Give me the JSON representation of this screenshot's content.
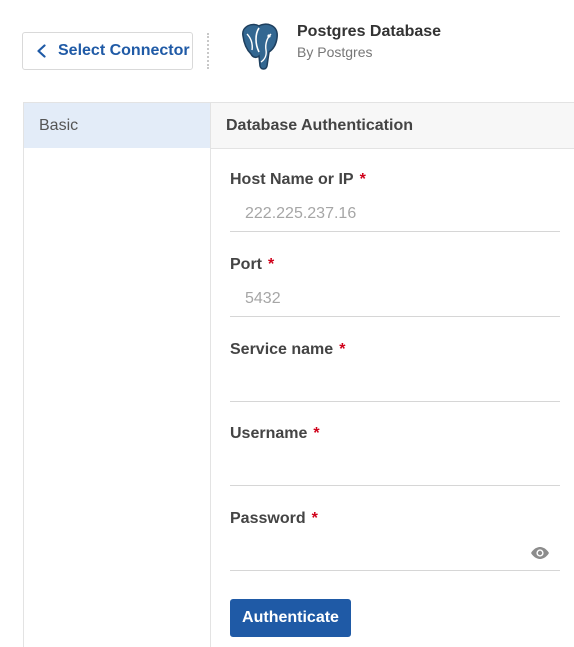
{
  "header": {
    "back_label": "Select Connector",
    "product_title": "Postgres Database",
    "product_subtitle": "By Postgres"
  },
  "nav": {
    "items": [
      {
        "label": "Basic",
        "selected": true
      }
    ]
  },
  "section": {
    "title": "Database Authentication"
  },
  "form": {
    "fields": [
      {
        "label": "Host Name or IP",
        "required_mark": "*",
        "value": "",
        "placeholder": "222.225.237.16"
      },
      {
        "label": "Port",
        "required_mark": "*",
        "value": "",
        "placeholder": "5432"
      },
      {
        "label": "Service name",
        "required_mark": "*",
        "value": "",
        "placeholder": ""
      },
      {
        "label": "Username",
        "required_mark": "*",
        "value": "",
        "placeholder": ""
      },
      {
        "label": "Password",
        "required_mark": "*",
        "value": "",
        "placeholder": "",
        "type": "password"
      }
    ],
    "submit_label": "Authenticate"
  },
  "icons": {
    "back": "chevron-left-icon",
    "logo": "postgres-elephant-logo",
    "password_toggle": "eye-icon"
  },
  "colors": {
    "accent": "#1f5aa6",
    "required": "#d0021b",
    "nav_selected_bg": "#e3ecf8"
  }
}
